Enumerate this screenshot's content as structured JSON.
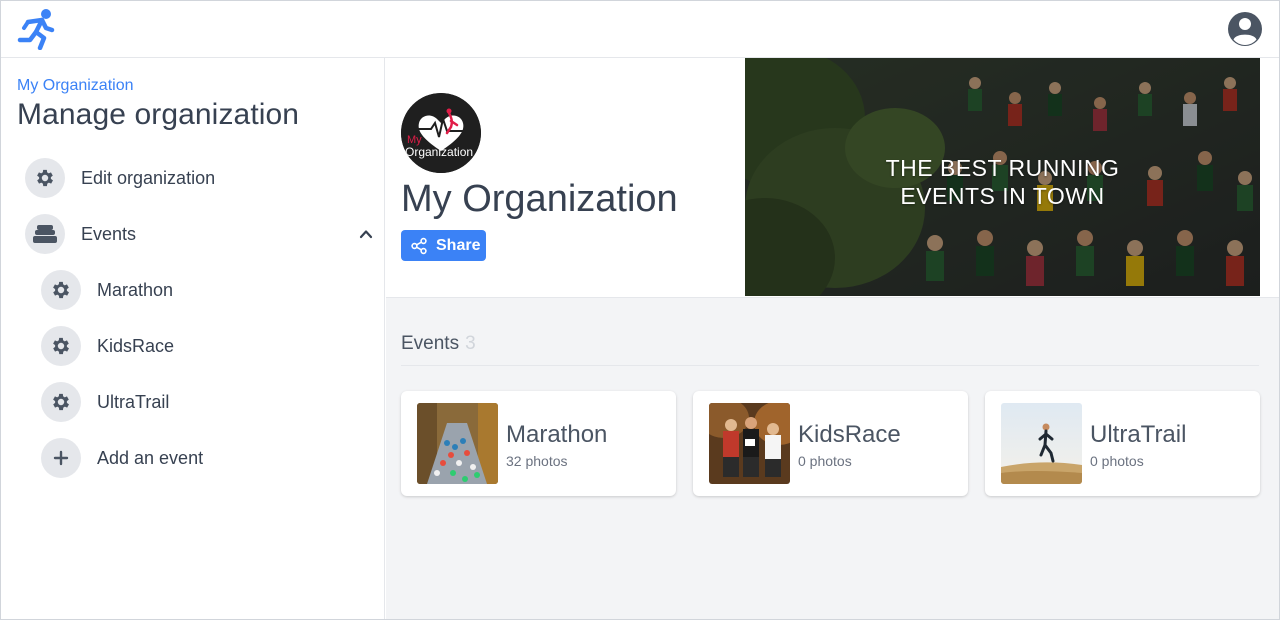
{
  "app": {
    "logo_icon": "running-man-icon",
    "user_icon": "user-circle-icon",
    "brand_color": "#3b82f6"
  },
  "sidebar": {
    "breadcrumb": "My Organization",
    "title": "Manage organization",
    "items": [
      {
        "label": "Edit organization",
        "icon": "gear-icon"
      },
      {
        "label": "Events",
        "icon": "layers-icon",
        "expanded": true,
        "toggle_icon": "chevron-up-icon"
      }
    ],
    "events": [
      {
        "label": "Marathon",
        "icon": "gear-icon"
      },
      {
        "label": "KidsRace",
        "icon": "gear-icon"
      },
      {
        "label": "UltraTrail",
        "icon": "gear-icon"
      }
    ],
    "add_event": {
      "label": "Add an event",
      "icon": "plus-icon"
    }
  },
  "organization": {
    "name": "My Organization",
    "logo_text_line1": "My",
    "logo_text_line2": "Organization",
    "share_label": "Share",
    "share_icon": "share-icon",
    "banner_line1": "THE BEST RUNNING",
    "banner_line2": "EVENTS IN TOWN"
  },
  "events_section": {
    "heading": "Events",
    "count": "3",
    "cards": [
      {
        "name": "Marathon",
        "photos": "32 photos"
      },
      {
        "name": "KidsRace",
        "photos": "0 photos"
      },
      {
        "name": "UltraTrail",
        "photos": "0 photos"
      }
    ]
  }
}
